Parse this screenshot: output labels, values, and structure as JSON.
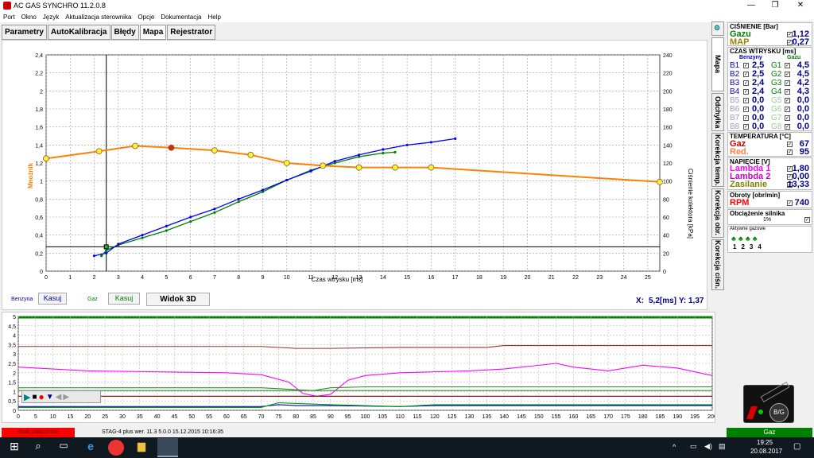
{
  "window": {
    "title": "AC GAS SYNCHRO  11.2.0.8",
    "minimize": "—",
    "maximize": "❐",
    "close": "✕"
  },
  "menu": [
    "Port",
    "Okno",
    "Język",
    "Aktualizacja sterownika",
    "Opcje",
    "Dokumentacja",
    "Help"
  ],
  "tabs": [
    "Parametry",
    "AutoKalibracja",
    "Błędy",
    "Mapa",
    "Rejestrator"
  ],
  "vertical_tabs": [
    "Mapa",
    "Odchyłka",
    "Korekcja temp.",
    "Korekcja obr.",
    "Korekcja ciśn."
  ],
  "chart_data": [
    {
      "type": "line",
      "xlabel": "Czas wtrysku [ms]",
      "ylabel": "Mnożnik",
      "y2label": "Ciśnienie kolektora [kPa]",
      "xlim": [
        0,
        25.5
      ],
      "ylim": [
        0,
        2.4
      ],
      "y2lim": [
        0,
        240
      ],
      "x_ticks": [
        0,
        1,
        2,
        3,
        4,
        5,
        6,
        7,
        8,
        9,
        10,
        11,
        12,
        13,
        14,
        15,
        16,
        17,
        18,
        19,
        20,
        21,
        22,
        23,
        24,
        25
      ],
      "y_ticks": [
        "0",
        "0,2",
        "0,4",
        "0,6",
        "0,8",
        "1",
        "1,2",
        "1,4",
        "1,6",
        "1,8",
        "2",
        "2,2",
        "2,4"
      ],
      "y2_ticks": [
        0,
        20,
        40,
        60,
        80,
        100,
        120,
        140,
        160,
        180,
        200,
        220,
        240
      ],
      "cursor": {
        "x": 2.5,
        "y": 0.27
      },
      "series": [
        {
          "role": "multiplier",
          "color": "#ff8000",
          "x": [
            0,
            2.2,
            3.7,
            5.2,
            7,
            8.5,
            10,
            11.5,
            13,
            14.5,
            16,
            25.5
          ],
          "values": [
            1.25,
            1.33,
            1.39,
            1.37,
            1.34,
            1.29,
            1.2,
            1.17,
            1.15,
            1.15,
            1.15,
            0.99
          ]
        },
        {
          "role": "petrol",
          "color": "#0000ff",
          "x": [
            2,
            2.5,
            3,
            4,
            5,
            6,
            7,
            8,
            9,
            10,
            11,
            12,
            13,
            14,
            15,
            16,
            17
          ],
          "values": [
            17,
            20,
            30,
            40,
            50,
            60,
            69,
            80,
            90,
            101,
            111,
            122,
            129,
            135,
            140,
            143,
            147
          ]
        },
        {
          "role": "gas",
          "color": "#008000",
          "x": [
            2.3,
            2.5,
            3,
            4,
            5,
            6,
            7,
            8,
            9,
            10,
            11,
            12,
            13,
            14,
            14.5
          ],
          "values": [
            17,
            23,
            29,
            37,
            45,
            55,
            65,
            77,
            88,
            101,
            112,
            120,
            127,
            131,
            132
          ]
        }
      ]
    },
    {
      "type": "line",
      "xlim": [
        0,
        200
      ],
      "ylim": [
        0,
        5
      ],
      "x_ticks": [
        0,
        5,
        10,
        15,
        20,
        25,
        30,
        35,
        40,
        45,
        50,
        55,
        60,
        65,
        70,
        75,
        80,
        85,
        90,
        95,
        100,
        105,
        110,
        115,
        120,
        125,
        130,
        135,
        140,
        145,
        150,
        155,
        160,
        165,
        170,
        175,
        180,
        185,
        190,
        195,
        200
      ],
      "y_ticks": [
        "0",
        "0,5",
        "1",
        "1,5",
        "2",
        "2,5",
        "3",
        "3,5",
        "4",
        "4,5",
        "5"
      ],
      "series": [
        {
          "role": "lambda-1",
          "color": "#ff00ff",
          "x": [
            0,
            10,
            20,
            40,
            60,
            70,
            78,
            82,
            86,
            90,
            95,
            100,
            110,
            120,
            130,
            140,
            150,
            155,
            160,
            170,
            180,
            190,
            200
          ],
          "values": [
            2.3,
            2.2,
            2.1,
            2.05,
            2.0,
            1.9,
            1.5,
            0.9,
            0.75,
            0.85,
            1.6,
            1.85,
            2.0,
            2.05,
            2.1,
            2.2,
            2.4,
            2.5,
            2.3,
            2.1,
            2.4,
            2.25,
            1.85
          ]
        },
        {
          "role": "reduktor",
          "color": "#a03030",
          "x": [
            0,
            70,
            80,
            90,
            110,
            135,
            140,
            200
          ],
          "values": [
            3.4,
            3.4,
            3.3,
            3.3,
            3.35,
            3.35,
            3.45,
            3.45
          ]
        },
        {
          "role": "green-a",
          "color": "#2e8b2e",
          "x": [
            0,
            70,
            75,
            80,
            85,
            90,
            100,
            200
          ],
          "values": [
            1.2,
            1.2,
            1.15,
            1.1,
            1.05,
            1.2,
            1.25,
            1.25
          ]
        },
        {
          "role": "green-b",
          "color": "#2e8b2e",
          "x": [
            0,
            200
          ],
          "values": [
            1.05,
            1.05
          ]
        },
        {
          "role": "dark-red",
          "color": "#800000",
          "x": [
            0,
            200
          ],
          "values": [
            0.75,
            0.75
          ]
        },
        {
          "role": "blue-low",
          "color": "#0000cc",
          "x": [
            0,
            70,
            75,
            80,
            90,
            110,
            120,
            200
          ],
          "values": [
            0.2,
            0.2,
            0.3,
            0.25,
            0.25,
            0.2,
            0.25,
            0.25
          ]
        },
        {
          "role": "green-low",
          "color": "#00a000",
          "x": [
            0,
            70,
            75,
            90,
            110,
            120,
            200
          ],
          "values": [
            0.15,
            0.15,
            0.4,
            0.3,
            0.2,
            0.3,
            0.3
          ]
        }
      ]
    }
  ],
  "controls": {
    "benzyna": "Benzyna",
    "kasuj1": "Kasuj",
    "gaz": "Gaz",
    "kasuj2": "Kasuj",
    "widok3d": "Widok 3D",
    "x_label": "X:",
    "x_value": "5,2[ms]",
    "y_label": "Y:",
    "y_value": "1,37"
  },
  "pressure": {
    "title": "CIŚNIENIE [Bar]",
    "gas_label": "Gazu",
    "gas_value": "1,12",
    "map_label": "MAP",
    "map_value": "0,27"
  },
  "injection": {
    "title": "CZAS WTRYSKU  [ms]",
    "col_petrol": "Benzyny",
    "col_gas": "Gazu",
    "rows": [
      {
        "b": "B1",
        "bv": "2,5",
        "g": "G1",
        "gv": "4,5"
      },
      {
        "b": "B2",
        "bv": "2,5",
        "g": "G2",
        "gv": "4,5"
      },
      {
        "b": "B3",
        "bv": "2,4",
        "g": "G3",
        "gv": "4,2"
      },
      {
        "b": "B4",
        "bv": "2,4",
        "g": "G4",
        "gv": "4,3"
      },
      {
        "b": "B5",
        "bv": "0,0",
        "g": "G5",
        "gv": "0,0"
      },
      {
        "b": "B6",
        "bv": "0,0",
        "g": "G6",
        "gv": "0,0"
      },
      {
        "b": "B7",
        "bv": "0,0",
        "g": "G7",
        "gv": "0,0"
      },
      {
        "b": "B8",
        "bv": "0,0",
        "g": "G8",
        "gv": "0,0"
      }
    ]
  },
  "temperature": {
    "title": "TEMPERATURA  [°C]",
    "gas_label": "Gaz",
    "gas_value": "67",
    "red_label": "Red.",
    "red_value": "95"
  },
  "voltage": {
    "title": "NAPIĘCIE [V]",
    "l1_label": "Lambda 1",
    "l1_value": "1,80",
    "l2_label": "Lambda 2",
    "l2_value": "0,00",
    "sup_label": "Zasilanie",
    "sup_value": "13,33"
  },
  "rpm": {
    "title": "Obroty [obr/min]",
    "label": "RPM",
    "value": "740"
  },
  "load": {
    "title": "Obciążenie silnika",
    "value": "1%"
  },
  "active_gas": {
    "title": "Aktywne gazowe",
    "nums": [
      "1",
      "2",
      "3",
      "4"
    ]
  },
  "switch": {
    "label": "B/G"
  },
  "status": {
    "conn": "Brak połączenia",
    "info": "STAG-4 plus   wer. 11.3  5.0.0   15.12.2015 10:16:35",
    "fuel": "Gaz"
  },
  "taskbar": {
    "time": "19:25",
    "date": "20.08.2017",
    "tray": "^"
  }
}
